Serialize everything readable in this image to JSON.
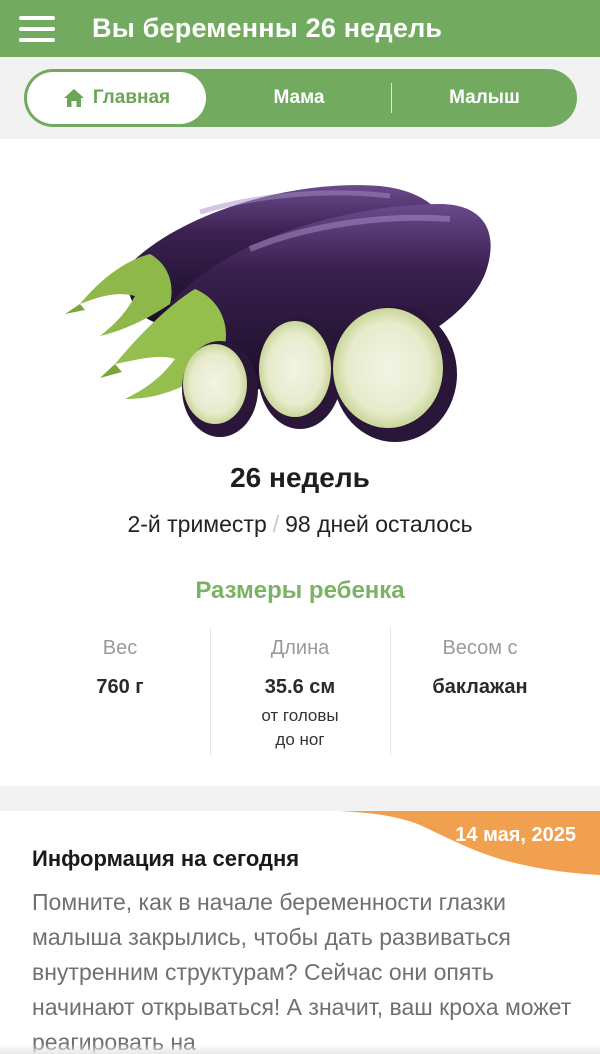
{
  "header": {
    "title": "Вы беременны 26 недель",
    "menu_icon": "hamburger-menu-icon"
  },
  "tabs": [
    {
      "label": "Главная",
      "icon": "home-icon",
      "active": true
    },
    {
      "label": "Мама",
      "active": false
    },
    {
      "label": "Малыш",
      "active": false
    }
  ],
  "summary": {
    "image": "eggplant",
    "week_title": "26 недель",
    "trimester": "2-й триместр",
    "separator": "/",
    "days_left": "98 дней осталось"
  },
  "baby_sizes": {
    "title": "Размеры ребенка",
    "weight": {
      "label": "Вес",
      "value": "760 г"
    },
    "length": {
      "label": "Длина",
      "value": "35.6 см",
      "note_line1": "от головы",
      "note_line2": "до ног"
    },
    "like": {
      "label": "Весом с",
      "value": "баклажан"
    }
  },
  "today": {
    "date": "14 мая, 2025",
    "title": "Информация на сегодня",
    "text": "Помните, как в начале беременности глазки малыша закрылись, чтобы дать развиваться внутренним структурам? Сейчас они опять начинают открываться! А значит, ваш кроха может реагировать на"
  },
  "colors": {
    "brand_green": "#72ab5f",
    "accent_orange": "#f0a04e",
    "text_grey": "#707070"
  }
}
